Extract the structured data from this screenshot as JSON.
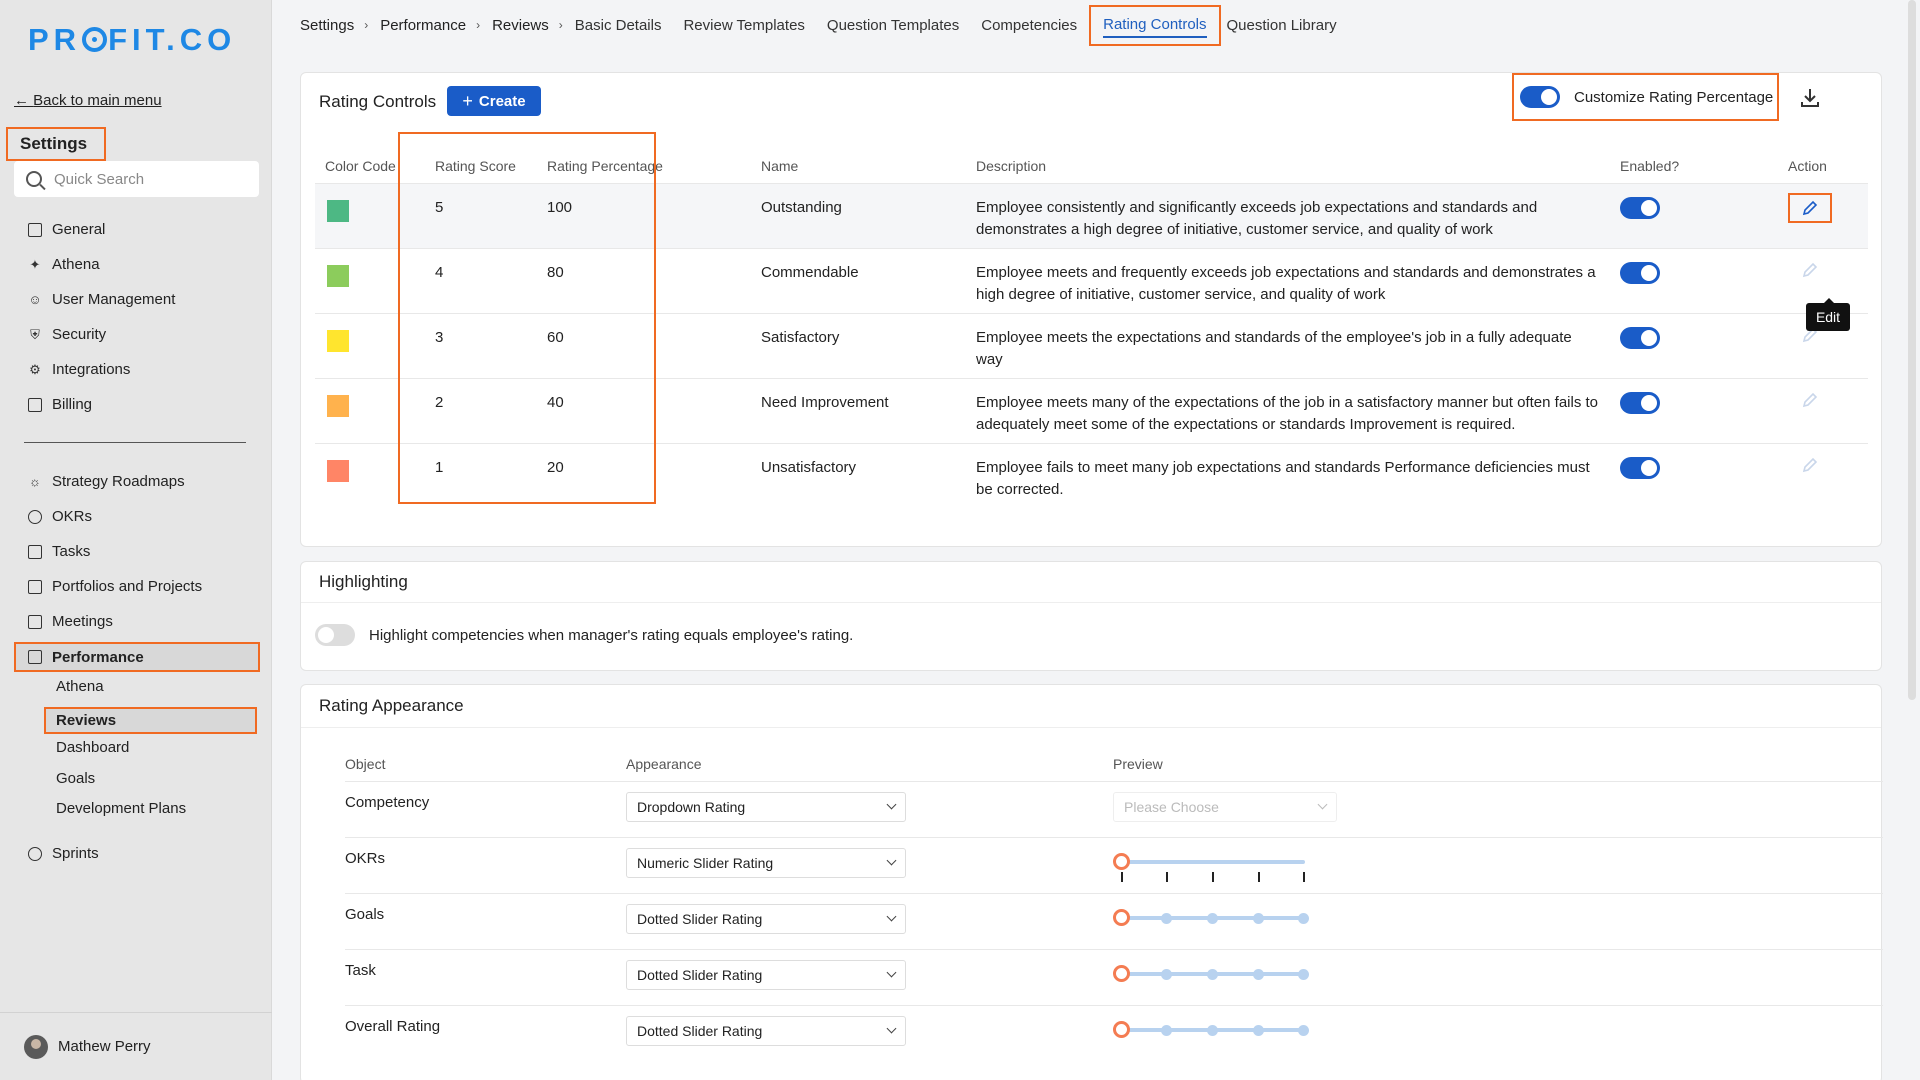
{
  "sidebar": {
    "logo": "PROFIT.CO",
    "back_label": "Back to main menu",
    "settings_title": "Settings",
    "search_placeholder": "Quick Search",
    "items_top": [
      {
        "label": "General",
        "icon": "monitor-icon"
      },
      {
        "label": "Athena",
        "icon": "sparkle-icon"
      },
      {
        "label": "User Management",
        "icon": "user-icon"
      },
      {
        "label": "Security",
        "icon": "shield-icon"
      },
      {
        "label": "Integrations",
        "icon": "gear-icon"
      },
      {
        "label": "Billing",
        "icon": "receipt-icon"
      }
    ],
    "items_bottom": [
      {
        "label": "Strategy Roadmaps",
        "icon": "bulb-icon"
      },
      {
        "label": "OKRs",
        "icon": "target-icon"
      },
      {
        "label": "Tasks",
        "icon": "clipboard-icon"
      },
      {
        "label": "Portfolios and Projects",
        "icon": "briefcase-icon"
      },
      {
        "label": "Meetings",
        "icon": "calendar-icon"
      }
    ],
    "performance": "Performance",
    "performance_sub": [
      "Athena",
      "Reviews",
      "Dashboard",
      "Goals",
      "Development Plans"
    ],
    "sprints": "Sprints",
    "user_name": "Mathew Perry"
  },
  "breadcrumb": [
    "Settings",
    "Performance",
    "Reviews"
  ],
  "tabs": [
    "Basic Details",
    "Review Templates",
    "Question Templates",
    "Competencies",
    "Rating Controls",
    "Question Library"
  ],
  "rating_controls": {
    "title": "Rating Controls",
    "create_label": "Create",
    "customize_label": "Customize Rating Percentage",
    "headers": [
      "Color Code",
      "Rating Score",
      "Rating Percentage",
      "Name",
      "Description",
      "Enabled?",
      "Action"
    ],
    "rows": [
      {
        "color": "#4db884",
        "score": "5",
        "percent": "100",
        "name": "Outstanding",
        "description": "Employee consistently and significantly exceeds job expectations and standards and demonstrates a high degree of initiative, customer service, and quality of work"
      },
      {
        "color": "#8ccc5c",
        "score": "4",
        "percent": "80",
        "name": "Commendable",
        "description": "Employee meets and frequently exceeds job expectations and standards and demonstrates a high degree of initiative, customer service, and quality of work"
      },
      {
        "color": "#ffe52e",
        "score": "3",
        "percent": "60",
        "name": "Satisfactory",
        "description": "Employee meets the expectations and standards of the employee's job in a fully adequate way"
      },
      {
        "color": "#ffb24d",
        "score": "2",
        "percent": "40",
        "name": "Need Improvement",
        "description": "Employee meets many of the expectations of the job in a satisfactory manner but often fails to adequately meet some of the expectations or standards Improvement is required."
      },
      {
        "color": "#ff8566",
        "score": "1",
        "percent": "20",
        "name": "Unsatisfactory",
        "description": "Employee fails to meet many job expectations and standards Performance deficiencies must be corrected."
      }
    ],
    "edit_tooltip": "Edit"
  },
  "highlighting": {
    "title": "Highlighting",
    "label": "Highlight competencies when manager's rating equals employee's rating."
  },
  "rating_appearance": {
    "title": "Rating Appearance",
    "headers": [
      "Object",
      "Appearance",
      "Preview"
    ],
    "rows": [
      {
        "object": "Competency",
        "appearance": "Dropdown Rating",
        "preview_placeholder": "Please Choose"
      },
      {
        "object": "OKRs",
        "appearance": "Numeric Slider Rating"
      },
      {
        "object": "Goals",
        "appearance": "Dotted Slider Rating"
      },
      {
        "object": "Task",
        "appearance": "Dotted Slider Rating"
      },
      {
        "object": "Overall Rating",
        "appearance": "Dotted Slider Rating"
      }
    ]
  },
  "colors": {
    "accent": "#1a5cc8",
    "highlight_border": "#f06a22"
  }
}
